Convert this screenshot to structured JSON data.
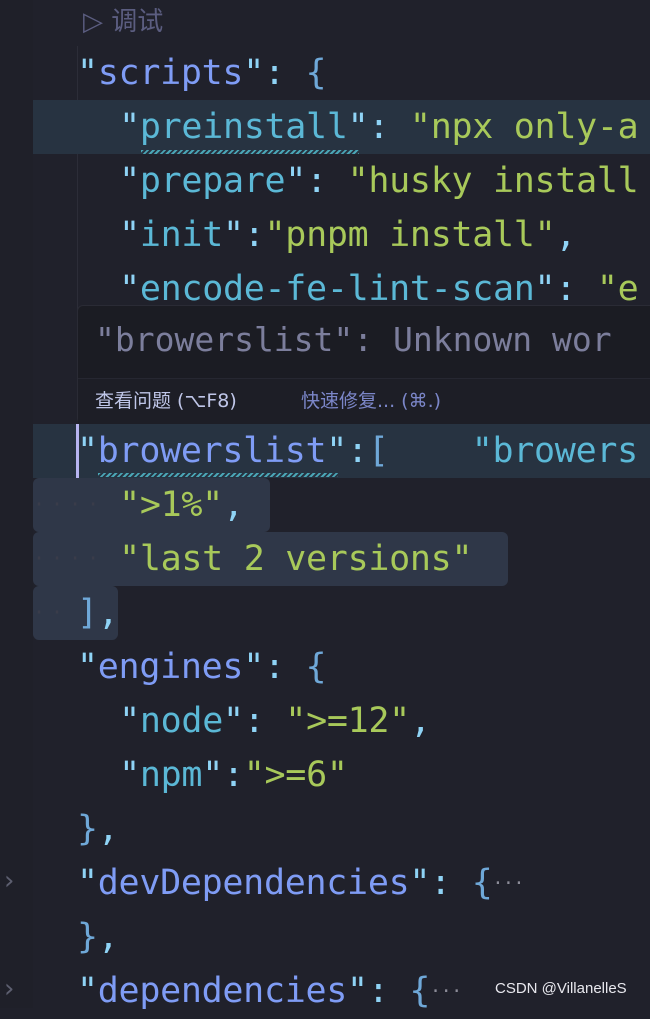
{
  "codelens": {
    "icon": "play-outline-icon",
    "label": "调试"
  },
  "lines": [
    {
      "name": "line-scripts",
      "indent": 1,
      "tokens": [
        [
          "\"",
          "p"
        ],
        [
          "scripts",
          "k1"
        ],
        [
          "\"",
          "p"
        ],
        [
          ": ",
          "p"
        ],
        [
          "{",
          "b"
        ]
      ]
    },
    {
      "name": "line-preinstall",
      "indent": 2,
      "tokens": [
        [
          "\"",
          "p"
        ],
        [
          "preinstall",
          "k2"
        ],
        [
          "\"",
          "p"
        ],
        [
          ": ",
          "p"
        ],
        [
          "\"npx only-a",
          "s"
        ]
      ]
    },
    {
      "name": "line-prepare",
      "indent": 2,
      "tokens": [
        [
          "\"",
          "p"
        ],
        [
          "prepare",
          "k2"
        ],
        [
          "\"",
          "p"
        ],
        [
          ": ",
          "p"
        ],
        [
          "\"husky install",
          "s"
        ]
      ]
    },
    {
      "name": "line-init",
      "indent": 2,
      "tokens": [
        [
          "\"",
          "p"
        ],
        [
          "init",
          "k2"
        ],
        [
          "\"",
          "p"
        ],
        [
          ":",
          "p"
        ],
        [
          "\"pnpm install\"",
          "s"
        ],
        [
          ",",
          "p"
        ]
      ]
    },
    {
      "name": "line-encode-fe-lint-scan",
      "indent": 2,
      "tokens": [
        [
          "\"",
          "p"
        ],
        [
          "encode-fe-lint-scan",
          "k2"
        ],
        [
          "\"",
          "p"
        ],
        [
          ": ",
          "p"
        ],
        [
          "\"e",
          "s"
        ]
      ]
    },
    {
      "name": "line-hidden-1",
      "indent": 2,
      "tokens": []
    },
    {
      "name": "line-hidden-2",
      "indent": 2,
      "tokens": []
    },
    {
      "name": "line-browerslist",
      "indent": 1,
      "tokens": [
        [
          "\"",
          "p"
        ],
        [
          "browerslist",
          "k1"
        ],
        [
          "\"",
          "p"
        ],
        [
          ":",
          "p"
        ],
        [
          "[",
          "b"
        ],
        [
          "    \"browers",
          "g"
        ]
      ]
    },
    {
      "name": "line-1-percent",
      "indent": 2,
      "tokens": [
        [
          "\">1%\"",
          "s"
        ],
        [
          ",",
          "p"
        ]
      ]
    },
    {
      "name": "line-last-2-versions",
      "indent": 2,
      "tokens": [
        [
          "\"last 2 versions\"",
          "s"
        ]
      ]
    },
    {
      "name": "line-array-close",
      "indent": 1,
      "tokens": [
        [
          "]",
          "b"
        ],
        [
          ",",
          "p"
        ]
      ]
    },
    {
      "name": "line-engines",
      "indent": 1,
      "tokens": [
        [
          "\"",
          "p"
        ],
        [
          "engines",
          "k1"
        ],
        [
          "\"",
          "p"
        ],
        [
          ": ",
          "p"
        ],
        [
          "{",
          "b"
        ]
      ]
    },
    {
      "name": "line-node",
      "indent": 2,
      "tokens": [
        [
          "\"",
          "p"
        ],
        [
          "node",
          "k2"
        ],
        [
          "\"",
          "p"
        ],
        [
          ": ",
          "p"
        ],
        [
          "\">=12\"",
          "s"
        ],
        [
          ",",
          "p"
        ]
      ]
    },
    {
      "name": "line-npm",
      "indent": 2,
      "tokens": [
        [
          "\"",
          "p"
        ],
        [
          "npm",
          "k2"
        ],
        [
          "\"",
          "p"
        ],
        [
          ":",
          "p"
        ],
        [
          "\">=6\"",
          "s"
        ]
      ]
    },
    {
      "name": "line-engines-close",
      "indent": 1,
      "tokens": [
        [
          "}",
          "b"
        ],
        [
          ",",
          "p"
        ]
      ]
    },
    {
      "name": "line-devDependencies",
      "indent": 1,
      "tokens": [
        [
          "\"",
          "p"
        ],
        [
          "devDependencies",
          "k1"
        ],
        [
          "\"",
          "p"
        ],
        [
          ": ",
          "p"
        ],
        [
          "{",
          "b"
        ],
        [
          "···",
          "ell"
        ]
      ]
    },
    {
      "name": "line-devDependencies-close",
      "indent": 1,
      "tokens": [
        [
          "}",
          "b"
        ],
        [
          ",",
          "p"
        ]
      ]
    },
    {
      "name": "line-dependencies",
      "indent": 1,
      "tokens": [
        [
          "\"",
          "p"
        ],
        [
          "dependencies",
          "k1"
        ],
        [
          "\"",
          "p"
        ],
        [
          ": ",
          "p"
        ],
        [
          "{",
          "b"
        ],
        [
          "···",
          "ell"
        ]
      ]
    }
  ],
  "hover": {
    "message": "\"browerslist\": Unknown wor",
    "view_problem": "查看问题 (⌥F8)",
    "quick_fix": "快速修复... (⌘.)"
  },
  "colors": {
    "background": "#20212b",
    "key": "#7f9cf5",
    "nested_key": "#5bb8d6",
    "string": "#a8c95a",
    "line_highlight": "#273341"
  },
  "watermark": "CSDN @VillanelleS"
}
